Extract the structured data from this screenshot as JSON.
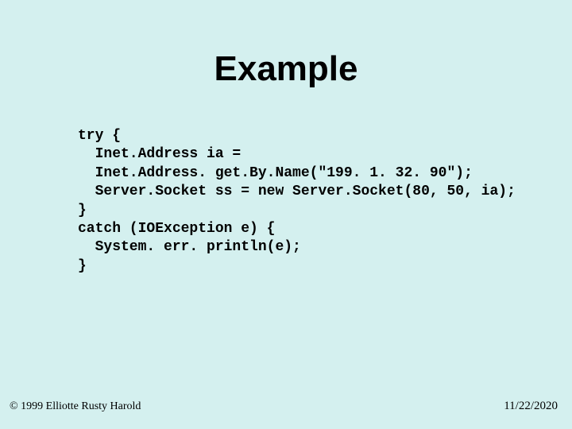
{
  "title": "Example",
  "code_lines": [
    "try {",
    "  Inet.Address ia =",
    "  Inet.Address. get.By.Name(\"199. 1. 32. 90\");",
    "  Server.Socket ss = new Server.Socket(80, 50, ia);",
    "}",
    "catch (IOException e) {",
    "  System. err. println(e);",
    "}"
  ],
  "copyright": "© 1999 Elliotte Rusty Harold",
  "date": "11/22/2020"
}
